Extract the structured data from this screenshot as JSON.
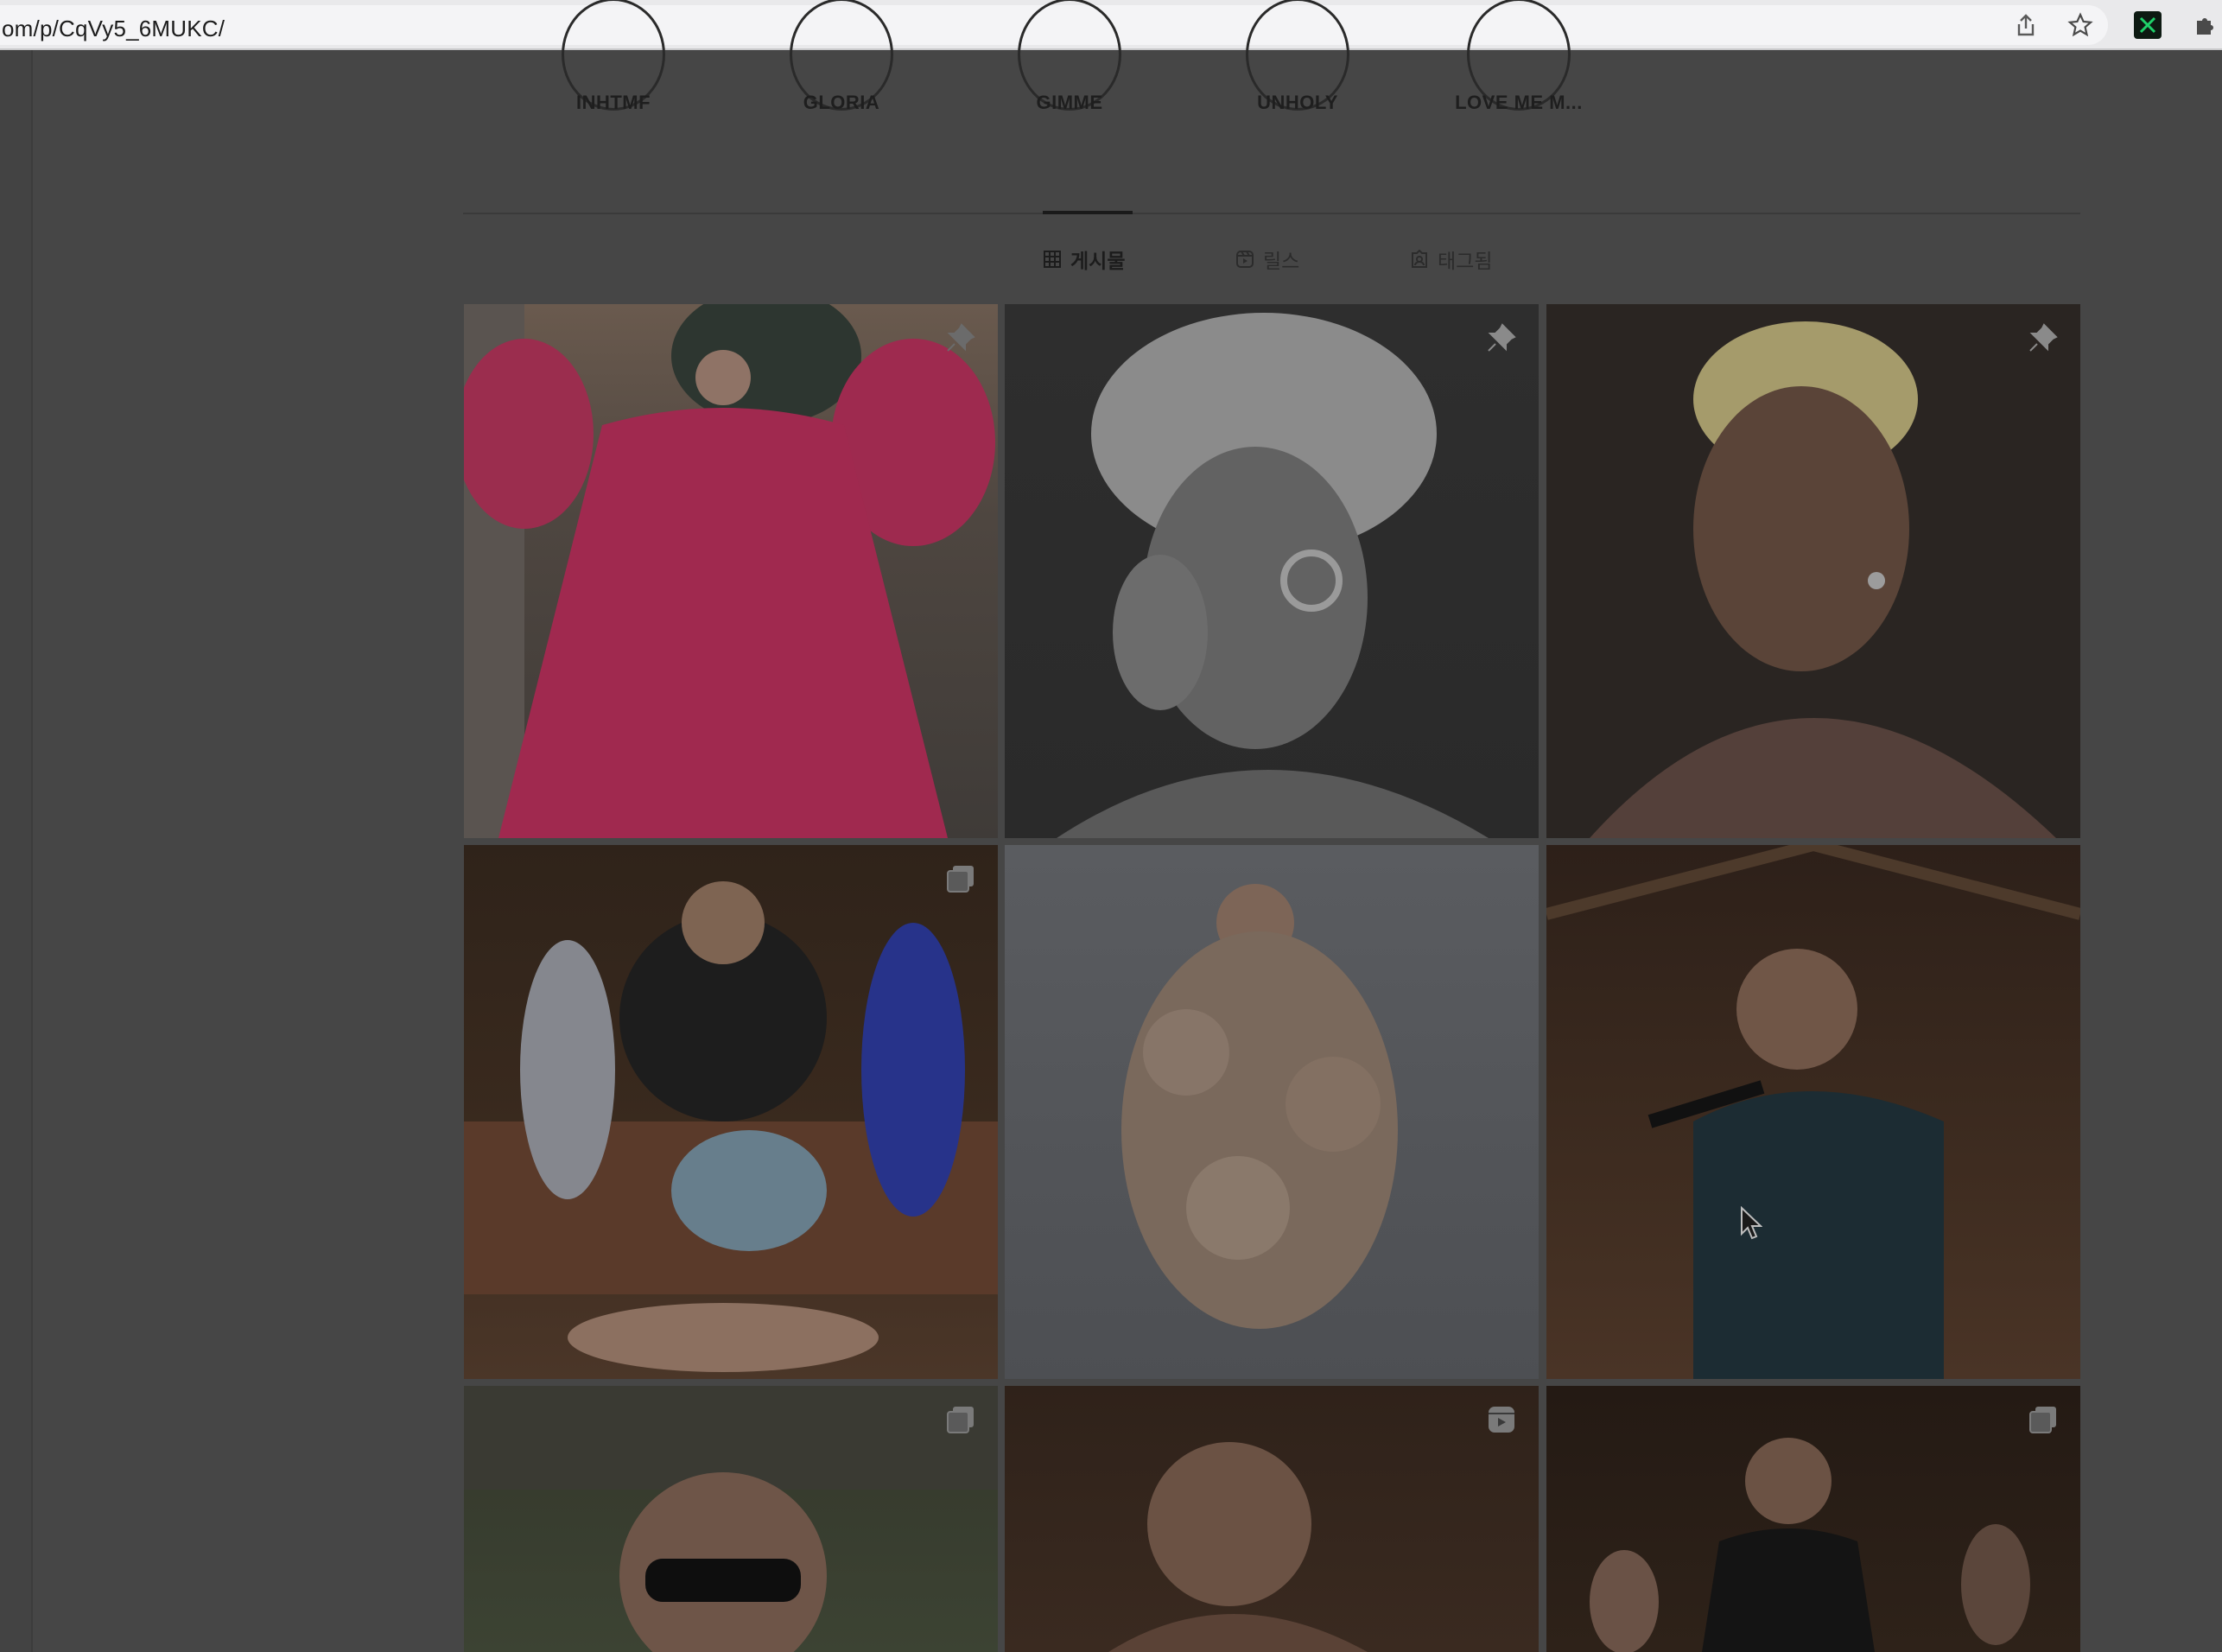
{
  "browser": {
    "url": "om/p/CqVy5_6MUKC/",
    "icons": [
      "share-icon",
      "bookmark-star-icon",
      "extension-icon",
      "puzzle-icon"
    ]
  },
  "highlights": [
    {
      "label": "INHTMF"
    },
    {
      "label": "GLORIA"
    },
    {
      "label": "GIMME"
    },
    {
      "label": "UNHOLY"
    },
    {
      "label": "LOVE ME M..."
    }
  ],
  "tabs": [
    {
      "label": "게시물",
      "icon": "grid-icon",
      "active": true
    },
    {
      "label": "릴스",
      "icon": "reels-icon",
      "active": false
    },
    {
      "label": "태그됨",
      "icon": "tagged-icon",
      "active": false
    }
  ],
  "posts": [
    {
      "badge": "pin-icon"
    },
    {
      "badge": "pin-icon"
    },
    {
      "badge": "pin-icon"
    },
    {
      "badge": "carousel-icon"
    },
    {
      "badge": ""
    },
    {
      "badge": ""
    },
    {
      "badge": "carousel-icon"
    },
    {
      "badge": "reel-icon"
    },
    {
      "badge": "carousel-icon"
    }
  ],
  "colors": {
    "overlay_background": "#464646",
    "text_dark": "#1e1e1e"
  }
}
